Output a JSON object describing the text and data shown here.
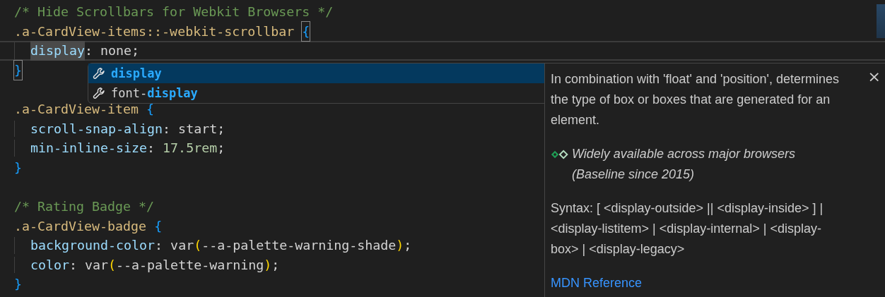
{
  "editor": {
    "lines": [
      {
        "indented": false,
        "current": false,
        "tokens": [
          {
            "kind": "comment",
            "text": "/* Hide Scrollbars for Webkit Browsers */"
          }
        ]
      },
      {
        "indented": false,
        "current": false,
        "tokens": [
          {
            "kind": "selector",
            "text": ".a-CardView-items::-webkit-scrollbar "
          },
          {
            "kind": "brace",
            "text": "{",
            "matched": true
          }
        ]
      },
      {
        "indented": true,
        "current": true,
        "tokens": [
          {
            "kind": "property",
            "text": "display",
            "highlighted": true
          },
          {
            "kind": "punct",
            "text": ": none;"
          }
        ]
      },
      {
        "indented": false,
        "current": false,
        "tokens": [
          {
            "kind": "brace",
            "text": "}",
            "matched": true
          }
        ]
      },
      {
        "indented": false,
        "current": false
      },
      {
        "indented": false,
        "current": false,
        "tokens": [
          {
            "kind": "selector",
            "text": ".a-CardView-item "
          },
          {
            "kind": "brace",
            "text": "{"
          }
        ]
      },
      {
        "indented": true,
        "current": false,
        "tokens": [
          {
            "kind": "property",
            "text": "scroll-snap-align"
          },
          {
            "kind": "punct",
            "text": ": start;"
          }
        ]
      },
      {
        "indented": true,
        "current": false,
        "tokens": [
          {
            "kind": "property",
            "text": "min-inline-size"
          },
          {
            "kind": "punct",
            "text": ": "
          },
          {
            "kind": "number",
            "text": "17.5rem"
          },
          {
            "kind": "punct",
            "text": ";"
          }
        ]
      },
      {
        "indented": false,
        "current": false,
        "tokens": [
          {
            "kind": "brace",
            "text": "}"
          }
        ]
      },
      {
        "indented": false,
        "current": false
      },
      {
        "indented": false,
        "current": false,
        "tokens": [
          {
            "kind": "comment",
            "text": "/* Rating Badge */"
          }
        ]
      },
      {
        "indented": false,
        "current": false,
        "tokens": [
          {
            "kind": "selector",
            "text": ".a-CardView-badge "
          },
          {
            "kind": "brace",
            "text": "{"
          }
        ]
      },
      {
        "indented": true,
        "current": false,
        "tokens": [
          {
            "kind": "property",
            "text": "background-color"
          },
          {
            "kind": "punct",
            "text": ": var"
          },
          {
            "kind": "paren",
            "text": "("
          },
          {
            "kind": "punct",
            "text": "--a-palette-warning-shade"
          },
          {
            "kind": "paren",
            "text": ")"
          },
          {
            "kind": "punct",
            "text": ";"
          }
        ]
      },
      {
        "indented": true,
        "current": false,
        "tokens": [
          {
            "kind": "property",
            "text": "color"
          },
          {
            "kind": "punct",
            "text": ": var"
          },
          {
            "kind": "paren",
            "text": "("
          },
          {
            "kind": "punct",
            "text": "--a-palette-warning"
          },
          {
            "kind": "paren",
            "text": ")"
          },
          {
            "kind": "punct",
            "text": ";"
          }
        ]
      },
      {
        "indented": false,
        "current": false,
        "tokens": [
          {
            "kind": "brace",
            "text": "}"
          }
        ]
      }
    ]
  },
  "suggestions": [
    {
      "match": "display",
      "selected": true
    },
    {
      "prefix": "font-",
      "match": "display",
      "selected": false
    }
  ],
  "hover": {
    "close": "×",
    "description": "In combination with 'float' and 'position', determines the type of box or boxes that are generated for an element.",
    "baseline": "Widely available across major browsers (Baseline since 2015)",
    "syntax": "Syntax: [ <display-outside> || <display-inside> ] | <display-listitem> | <display-internal> | <display-box> | <display-legacy>",
    "link": "MDN Reference"
  }
}
